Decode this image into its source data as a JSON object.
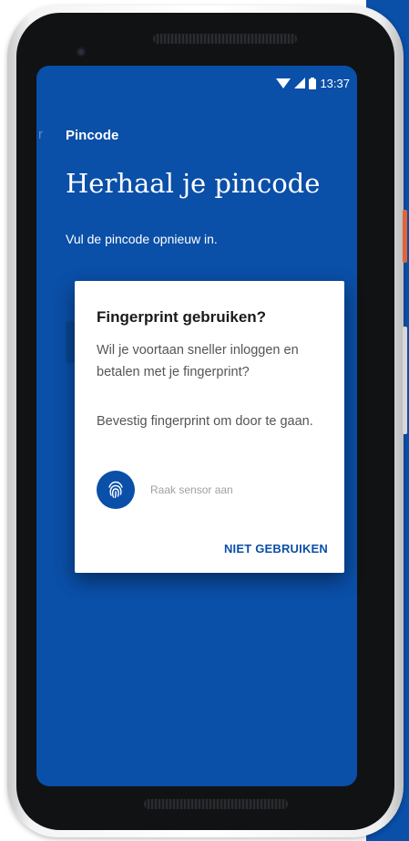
{
  "colors": {
    "brand_blue": "#0a4fa8",
    "dialog_bg": "#ffffff",
    "body_text": "#555555",
    "hint_text": "#a0a0a0"
  },
  "status_bar": {
    "time": "13:37",
    "icons": [
      "wifi-icon",
      "signal-icon",
      "battery-icon"
    ]
  },
  "screen": {
    "back_hint": "r",
    "toolbar_title": "Pincode",
    "title": "Herhaal je pincode",
    "subtitle": "Vul de pincode opnieuw in."
  },
  "dialog": {
    "title": "Fingerprint gebruiken?",
    "body": "Wil je voortaan sneller inloggen en betalen met je fingerprint?",
    "confirm": "Bevestig fingerprint om door te gaan.",
    "sensor_hint": "Raak sensor aan",
    "sensor_icon": "fingerprint-icon",
    "action_label": "NIET GEBRUIKEN"
  }
}
